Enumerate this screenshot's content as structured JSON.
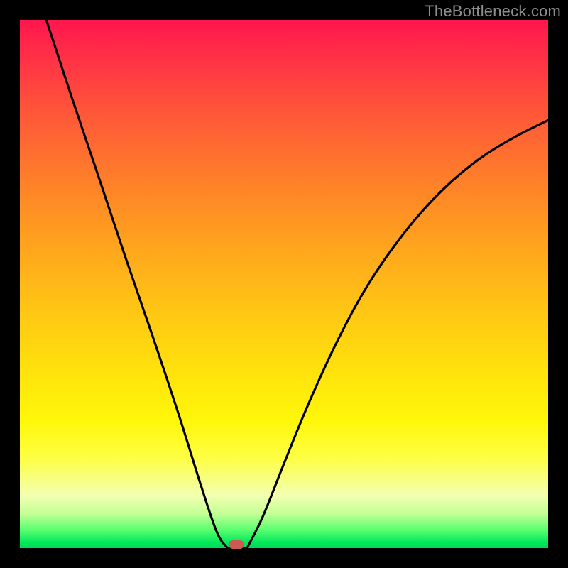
{
  "watermark": "TheBottleneck.com",
  "colors": {
    "frame": "#000000",
    "gradient_top": "#ff164e",
    "gradient_bottom": "#00d856",
    "curve": "#000000",
    "marker": "#cc5a54",
    "watermark": "#8e8e8e"
  },
  "marker": {
    "x_frac": 0.41,
    "y_frac": 0.993
  },
  "chart_data": {
    "type": "line",
    "title": "",
    "xlabel": "",
    "ylabel": "",
    "xlim": [
      0,
      1
    ],
    "ylim": [
      0,
      1
    ],
    "note": "V-shaped bottleneck curve on vertical red→green gradient. Minimum (≈0 bottleneck) near x≈0.40. Small rounded marker at the minimum.",
    "series": [
      {
        "name": "left-branch",
        "x": [
          0.05,
          0.1,
          0.15,
          0.2,
          0.25,
          0.3,
          0.343,
          0.373,
          0.393
        ],
        "y": [
          1.0,
          0.848,
          0.7,
          0.55,
          0.405,
          0.255,
          0.118,
          0.03,
          0.0
        ]
      },
      {
        "name": "right-branch",
        "x": [
          0.43,
          0.46,
          0.5,
          0.545,
          0.6,
          0.66,
          0.73,
          0.8,
          0.87,
          0.94,
          1.0
        ],
        "y": [
          0.0,
          0.06,
          0.16,
          0.27,
          0.39,
          0.5,
          0.6,
          0.678,
          0.737,
          0.78,
          0.81
        ]
      }
    ],
    "flat_segment": {
      "x": [
        0.393,
        0.43
      ],
      "y": 0.0
    }
  }
}
